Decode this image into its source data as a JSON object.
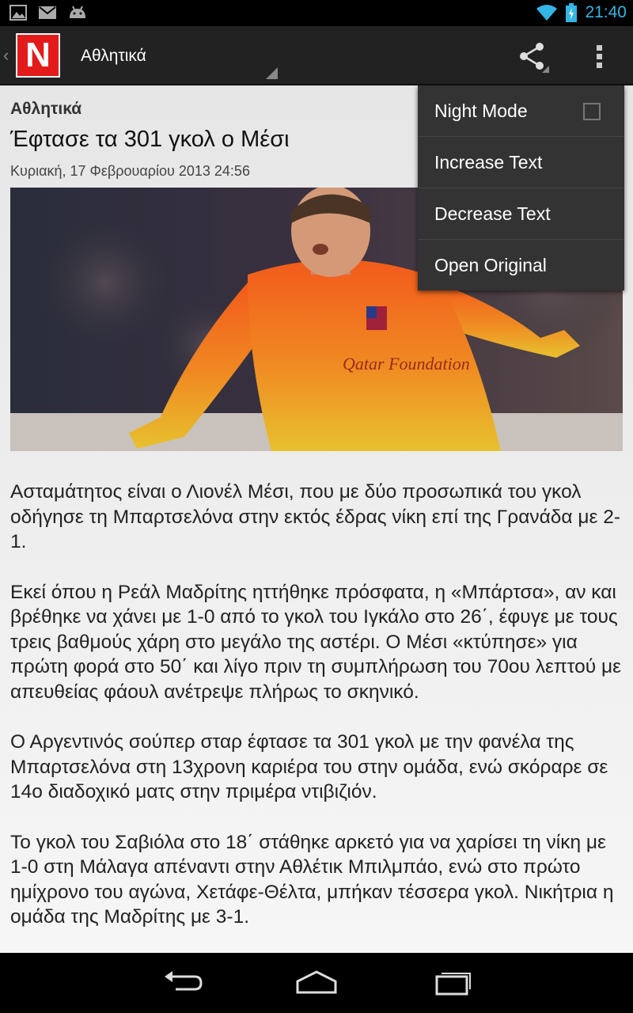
{
  "status_bar": {
    "time": "21:40",
    "icons": [
      "gallery-icon",
      "gmail-icon",
      "android-icon",
      "wifi-icon",
      "battery-icon"
    ]
  },
  "action_bar": {
    "logo_letter": "N",
    "section_title": "Αθλητικά",
    "share_icon": "share-icon",
    "overflow_icon": "overflow-menu-icon"
  },
  "article": {
    "category": "Αθλητικά",
    "title": "Έφτασε τα 301 γκολ ο Μέσι",
    "date": "Κυριακή, 17 Φεβρουαρίου 2013 24:56",
    "paragraphs": [
      "Ασταμάτητος είναι ο Λιονέλ Μέσι, που με δύο προσωπικά του γκολ οδήγησε τη Μπαρτσελόνα στην εκτός έδρας νίκη επί της Γρανάδα με 2-1.",
      "Εκεί όπου η Ρεάλ Μαδρίτης ηττήθηκε πρόσφατα, η «Μπάρτσα», αν και βρέθηκε να χάνει με 1-0 από το  γκολ του Ιγκάλο στο 26΄, έφυγε με τους τρεις βαθμούς χάρη στο μεγάλο της αστέρι. Ο Μέσι «κτύπησε» για πρώτη φορά στο 50΄ και λίγο πριν τη συμπλήρωση του 70ου λεπτού με απευθείας φάουλ ανέτρεψε πλήρως το σκηνικό.",
      "Ο Αργεντινός σούπερ σταρ έφτασε τα 301 γκολ με την φανέλα της Μπαρτσελόνα στη 13χρονη καριέρα του στην ομάδα, ενώ σκόραρε σε 14ο διαδοχικό ματς στην πριμέρα ντιβιζιόν.",
      "Το γκολ του Σαβιόλα στο 18΄ στάθηκε αρκετό για να χαρίσει τη νίκη με 1-0 στη Μάλαγα απέναντι στην Αθλέτικ Μπιλμπάο, ενώ στο πρώτο ημίχρονο του αγώνα, Χετάφε-Θέλτα, μπήκαν τέσσερα γκολ. Νικήτρια η ομάδα της Μαδρίτης με 3-1."
    ],
    "jersey_text": "Qatar Foundation"
  },
  "overflow_menu": {
    "items": [
      {
        "label": "Night Mode",
        "checked": false
      },
      {
        "label": "Increase Text"
      },
      {
        "label": "Decrease Text"
      },
      {
        "label": "Open Original"
      }
    ]
  },
  "nav_bar": {
    "buttons": [
      "back-icon",
      "home-icon",
      "recent-apps-icon"
    ]
  }
}
